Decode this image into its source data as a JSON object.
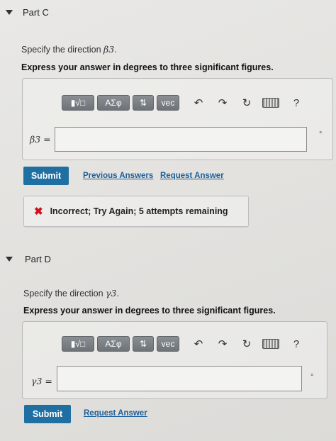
{
  "part_c": {
    "title": "Part C",
    "prompt_prefix": "Specify the direction ",
    "prompt_var": "β3",
    "prompt_suffix": ".",
    "instruction": "Express your answer in degrees to three significant figures.",
    "eq_label_var": "β3",
    "eq_label_sign": " =",
    "input_value": "",
    "unit": "°",
    "submit_label": "Submit",
    "previous_answers_label": "Previous Answers",
    "request_answer_label": "Request Answer",
    "feedback": "Incorrect; Try Again; 5 attempts remaining",
    "feedback_icon": "✖"
  },
  "part_d": {
    "title": "Part D",
    "prompt_prefix": "Specify the direction ",
    "prompt_var": "γ3",
    "prompt_suffix": ".",
    "instruction": "Express your answer in degrees to three significant figures.",
    "eq_label_var": "γ3",
    "eq_label_sign": " =",
    "input_value": "",
    "unit": "°",
    "submit_label": "Submit",
    "request_answer_label": "Request Answer"
  },
  "toolbar": {
    "templates_label": "▮√□",
    "greek_label": "ΑΣφ",
    "sort_label": "⇅",
    "vec_label": "vec",
    "undo_glyph": "↶",
    "redo_glyph": "↷",
    "reset_glyph": "↻",
    "help_glyph": "?"
  },
  "colors": {
    "submit_bg": "#1f6fa3",
    "link": "#1e5f99",
    "error": "#d0101e",
    "toolbar_btn": "#7a7f84"
  }
}
